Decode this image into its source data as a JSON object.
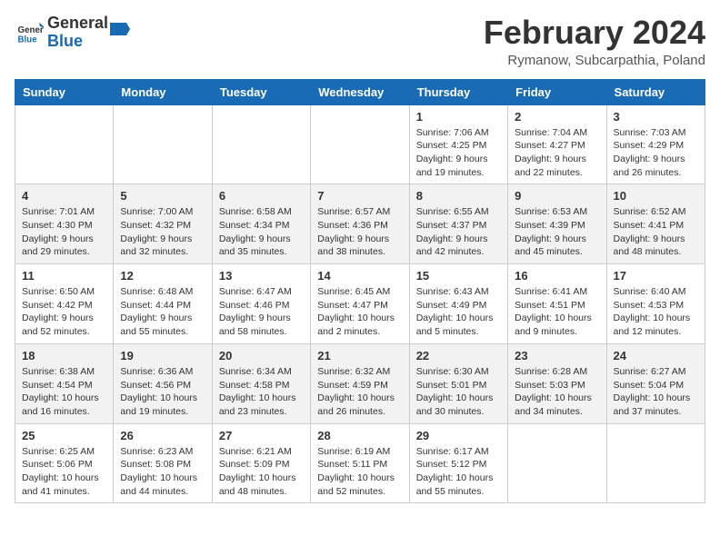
{
  "header": {
    "logo_general": "General",
    "logo_blue": "Blue",
    "month_title": "February 2024",
    "location": "Rymanow, Subcarpathia, Poland"
  },
  "days_of_week": [
    "Sunday",
    "Monday",
    "Tuesday",
    "Wednesday",
    "Thursday",
    "Friday",
    "Saturday"
  ],
  "weeks": [
    {
      "shaded": false,
      "days": [
        {
          "date": "",
          "info": ""
        },
        {
          "date": "",
          "info": ""
        },
        {
          "date": "",
          "info": ""
        },
        {
          "date": "",
          "info": ""
        },
        {
          "date": "1",
          "info": "Sunrise: 7:06 AM\nSunset: 4:25 PM\nDaylight: 9 hours\nand 19 minutes."
        },
        {
          "date": "2",
          "info": "Sunrise: 7:04 AM\nSunset: 4:27 PM\nDaylight: 9 hours\nand 22 minutes."
        },
        {
          "date": "3",
          "info": "Sunrise: 7:03 AM\nSunset: 4:29 PM\nDaylight: 9 hours\nand 26 minutes."
        }
      ]
    },
    {
      "shaded": true,
      "days": [
        {
          "date": "4",
          "info": "Sunrise: 7:01 AM\nSunset: 4:30 PM\nDaylight: 9 hours\nand 29 minutes."
        },
        {
          "date": "5",
          "info": "Sunrise: 7:00 AM\nSunset: 4:32 PM\nDaylight: 9 hours\nand 32 minutes."
        },
        {
          "date": "6",
          "info": "Sunrise: 6:58 AM\nSunset: 4:34 PM\nDaylight: 9 hours\nand 35 minutes."
        },
        {
          "date": "7",
          "info": "Sunrise: 6:57 AM\nSunset: 4:36 PM\nDaylight: 9 hours\nand 38 minutes."
        },
        {
          "date": "8",
          "info": "Sunrise: 6:55 AM\nSunset: 4:37 PM\nDaylight: 9 hours\nand 42 minutes."
        },
        {
          "date": "9",
          "info": "Sunrise: 6:53 AM\nSunset: 4:39 PM\nDaylight: 9 hours\nand 45 minutes."
        },
        {
          "date": "10",
          "info": "Sunrise: 6:52 AM\nSunset: 4:41 PM\nDaylight: 9 hours\nand 48 minutes."
        }
      ]
    },
    {
      "shaded": false,
      "days": [
        {
          "date": "11",
          "info": "Sunrise: 6:50 AM\nSunset: 4:42 PM\nDaylight: 9 hours\nand 52 minutes."
        },
        {
          "date": "12",
          "info": "Sunrise: 6:48 AM\nSunset: 4:44 PM\nDaylight: 9 hours\nand 55 minutes."
        },
        {
          "date": "13",
          "info": "Sunrise: 6:47 AM\nSunset: 4:46 PM\nDaylight: 9 hours\nand 58 minutes."
        },
        {
          "date": "14",
          "info": "Sunrise: 6:45 AM\nSunset: 4:47 PM\nDaylight: 10 hours\nand 2 minutes."
        },
        {
          "date": "15",
          "info": "Sunrise: 6:43 AM\nSunset: 4:49 PM\nDaylight: 10 hours\nand 5 minutes."
        },
        {
          "date": "16",
          "info": "Sunrise: 6:41 AM\nSunset: 4:51 PM\nDaylight: 10 hours\nand 9 minutes."
        },
        {
          "date": "17",
          "info": "Sunrise: 6:40 AM\nSunset: 4:53 PM\nDaylight: 10 hours\nand 12 minutes."
        }
      ]
    },
    {
      "shaded": true,
      "days": [
        {
          "date": "18",
          "info": "Sunrise: 6:38 AM\nSunset: 4:54 PM\nDaylight: 10 hours\nand 16 minutes."
        },
        {
          "date": "19",
          "info": "Sunrise: 6:36 AM\nSunset: 4:56 PM\nDaylight: 10 hours\nand 19 minutes."
        },
        {
          "date": "20",
          "info": "Sunrise: 6:34 AM\nSunset: 4:58 PM\nDaylight: 10 hours\nand 23 minutes."
        },
        {
          "date": "21",
          "info": "Sunrise: 6:32 AM\nSunset: 4:59 PM\nDaylight: 10 hours\nand 26 minutes."
        },
        {
          "date": "22",
          "info": "Sunrise: 6:30 AM\nSunset: 5:01 PM\nDaylight: 10 hours\nand 30 minutes."
        },
        {
          "date": "23",
          "info": "Sunrise: 6:28 AM\nSunset: 5:03 PM\nDaylight: 10 hours\nand 34 minutes."
        },
        {
          "date": "24",
          "info": "Sunrise: 6:27 AM\nSunset: 5:04 PM\nDaylight: 10 hours\nand 37 minutes."
        }
      ]
    },
    {
      "shaded": false,
      "days": [
        {
          "date": "25",
          "info": "Sunrise: 6:25 AM\nSunset: 5:06 PM\nDaylight: 10 hours\nand 41 minutes."
        },
        {
          "date": "26",
          "info": "Sunrise: 6:23 AM\nSunset: 5:08 PM\nDaylight: 10 hours\nand 44 minutes."
        },
        {
          "date": "27",
          "info": "Sunrise: 6:21 AM\nSunset: 5:09 PM\nDaylight: 10 hours\nand 48 minutes."
        },
        {
          "date": "28",
          "info": "Sunrise: 6:19 AM\nSunset: 5:11 PM\nDaylight: 10 hours\nand 52 minutes."
        },
        {
          "date": "29",
          "info": "Sunrise: 6:17 AM\nSunset: 5:12 PM\nDaylight: 10 hours\nand 55 minutes."
        },
        {
          "date": "",
          "info": ""
        },
        {
          "date": "",
          "info": ""
        }
      ]
    }
  ]
}
